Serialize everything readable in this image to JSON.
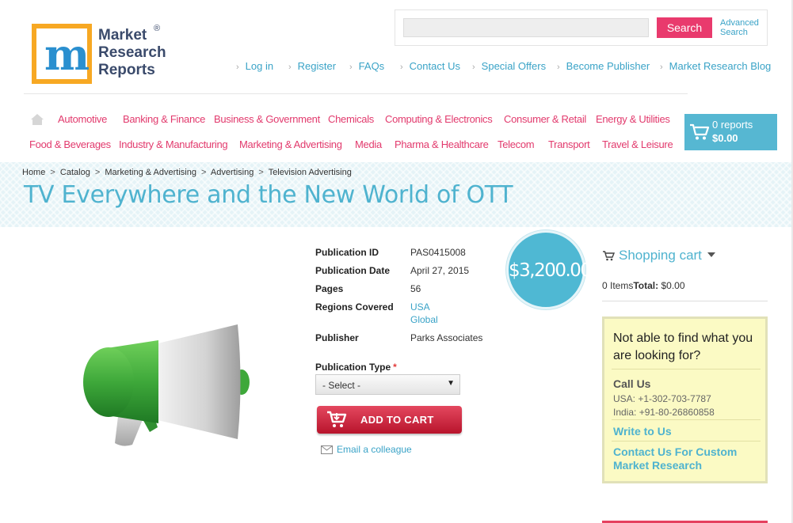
{
  "header": {
    "logo": {
      "line1": "Market",
      "line2": "Research",
      "line3": "Reports",
      "registered": "®",
      "mark_letter": "m"
    },
    "search": {
      "placeholder": "",
      "button_label": "Search",
      "advanced_label": "Advanced Search"
    },
    "top_links": [
      "Log in",
      "Register",
      "FAQs",
      "Contact Us",
      "Special Offers",
      "Become Publisher",
      "Market Research Blog"
    ]
  },
  "categories": {
    "row1": [
      "Automotive",
      "Banking & Finance",
      "Business & Government",
      "Chemicals",
      "Computing & Electronics",
      "Consumer & Retail",
      "Energy & Utilities"
    ],
    "row2": [
      "Food & Beverages",
      "Industry & Manufacturing",
      "Marketing & Advertising",
      "Media",
      "Pharma & Healthcare",
      "Telecom",
      "Transport",
      "Travel & Leisure"
    ],
    "home_icon": "home-icon"
  },
  "cart_widget": {
    "count": "0 reports",
    "total": "$0.00"
  },
  "breadcrumb": [
    "Home",
    "Catalog",
    "Marketing & Advertising",
    "Advertising",
    "Television Advertising"
  ],
  "breadcrumb_sep": ">",
  "page_title": "TV Everywhere and the New World of OTT",
  "product": {
    "price": "$3,200.00",
    "labels": {
      "publication_id": "Publication ID",
      "publication_date": "Publication Date",
      "pages": "Pages",
      "regions": "Regions Covered",
      "publisher": "Publisher"
    },
    "publication_id": "PAS0415008",
    "publication_date": "April 27, 2015",
    "pages": "56",
    "regions": [
      "USA",
      "Global"
    ],
    "publisher": "Parks Associates",
    "publication_type_label": "Publication Type",
    "required_mark": "*",
    "publication_type_selected": "- Select -",
    "add_to_cart_label": "ADD TO CART",
    "email_colleague_label": "Email a colleague"
  },
  "sidebar": {
    "shopping_cart_title": "Shopping cart",
    "items_text": "0 Items",
    "total_label": "Total:",
    "total_value": "$0.00",
    "help_question": "Not able to find what you are looking for?",
    "call_us": "Call Us",
    "phone_usa": "USA: +1-302-703-7787",
    "phone_india": "India: +91-80-26860858",
    "write_to_us": "Write to Us",
    "contact_custom": "Contact Us For Custom Market Research"
  },
  "colors": {
    "accent_pink": "#e23a6d",
    "accent_blue": "#4fb3cf",
    "cart_red": "#c51d37"
  }
}
